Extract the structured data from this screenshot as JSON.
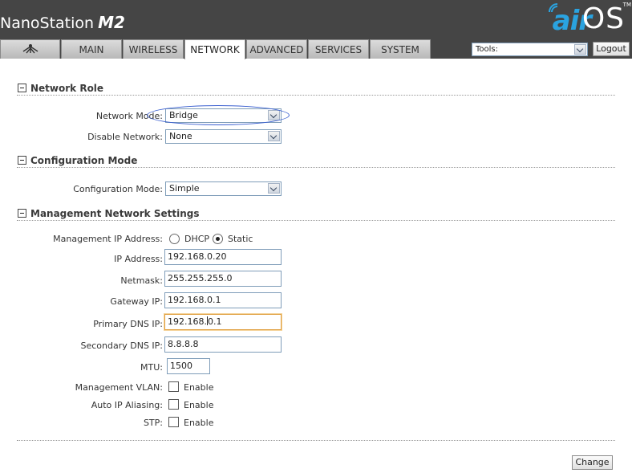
{
  "header": {
    "brand": "NanoStation",
    "model": "M2",
    "logo_air": "air",
    "logo_os": "OS",
    "logo_tm": "TM"
  },
  "tabs": [
    {
      "label": "",
      "icon": "ubiquiti-antenna-icon"
    },
    {
      "label": "MAIN"
    },
    {
      "label": "WIRELESS"
    },
    {
      "label": "NETWORK",
      "active": true
    },
    {
      "label": "ADVANCED"
    },
    {
      "label": "SERVICES"
    },
    {
      "label": "SYSTEM"
    }
  ],
  "tools": {
    "value": "Tools:"
  },
  "logout_label": "Logout",
  "sections": {
    "network_role": "Network Role",
    "config_mode": "Configuration Mode",
    "mgmt": "Management Network Settings"
  },
  "network_role": {
    "mode_label": "Network Mode:",
    "mode_value": "Bridge",
    "disable_label": "Disable Network:",
    "disable_value": "None"
  },
  "config": {
    "label": "Configuration Mode:",
    "value": "Simple"
  },
  "mgmt": {
    "ip_mode_label": "Management IP Address:",
    "dhcp": "DHCP",
    "static": "Static",
    "ip_label": "IP Address:",
    "ip_value": "192.168.0.20",
    "netmask_label": "Netmask:",
    "netmask_value": "255.255.255.0",
    "gateway_label": "Gateway IP:",
    "gateway_value": "192.168.0.1",
    "pdns_label": "Primary DNS IP:",
    "pdns_value_a": "192.168.",
    "pdns_value_b": "0.1",
    "sdns_label": "Secondary DNS IP:",
    "sdns_value": "8.8.8.8",
    "mtu_label": "MTU:",
    "mtu_value": "1500",
    "vlan_label": "Management VLAN:",
    "alias_label": "Auto IP Aliasing:",
    "stp_label": "STP:",
    "enable": "Enable"
  },
  "change_label": "Change",
  "colors": {
    "header": "#454545",
    "air": "#2aa3e0",
    "highlight": "#3a5fd0"
  }
}
